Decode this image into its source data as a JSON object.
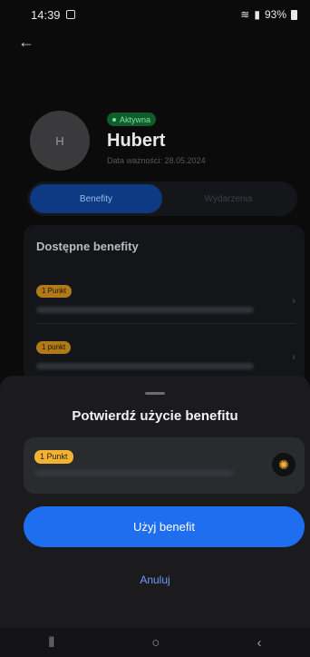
{
  "status_bar": {
    "time": "14:39",
    "battery": "93%",
    "icons": [
      "gallery-icon",
      "wifi-icon",
      "call-icon",
      "signal-icon",
      "battery-icon"
    ]
  },
  "header": {
    "back_icon": "arrow-left-icon"
  },
  "profile": {
    "avatar_initial": "H",
    "status_badge": "Aktywna",
    "name": "Hubert",
    "validity": "Data ważności: 28.05.2024"
  },
  "tabs": [
    {
      "label": "Benefity",
      "active": true
    },
    {
      "label": "Wydarzenia",
      "active": false
    }
  ],
  "benefits": {
    "title": "Dostępne benefity",
    "items": [
      {
        "badge": "1 Punkt"
      },
      {
        "badge": "1 punkt"
      }
    ]
  },
  "sheet": {
    "title": "Potwierdź użycie benefitu",
    "selected_badge": "1 Punkt",
    "use_button": "Użyj benefit",
    "cancel": "Anuluj"
  },
  "colors": {
    "accent": "#1f6ef0",
    "badge": "#f2b233",
    "active_badge": "#0f5d2b"
  }
}
